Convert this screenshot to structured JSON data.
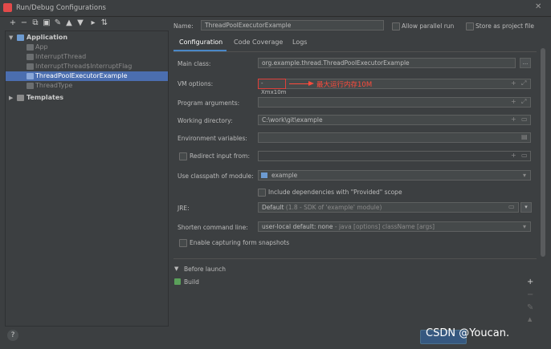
{
  "window": {
    "title": "Run/Debug Configurations"
  },
  "toolbar": {
    "icons": [
      "plus-icon",
      "minus-icon",
      "copy-icon",
      "save-icon",
      "wrench-icon",
      "arrow-up-icon",
      "arrow-down-icon",
      "folder-icon",
      "sort-icon"
    ],
    "glyphs": [
      "+",
      "−",
      "⧉",
      "▣",
      "✎",
      "▲",
      "▼",
      "▸",
      "⇅"
    ]
  },
  "tree": {
    "application_label": "Application",
    "items": [
      {
        "label": "App",
        "selected": false
      },
      {
        "label": "InterruptThread",
        "selected": false
      },
      {
        "label": "InterruptThread$InterruptFlag",
        "selected": false
      },
      {
        "label": "ThreadPoolExecutorExample",
        "selected": true
      },
      {
        "label": "ThreadType",
        "selected": false
      }
    ],
    "templates_label": "Templates"
  },
  "header": {
    "name_label": "Name:",
    "name_value": "ThreadPoolExecutorExample",
    "allow_parallel_label": "Allow parallel run",
    "store_project_label": "Store as project file"
  },
  "tabs": [
    "Configuration",
    "Code Coverage",
    "Logs"
  ],
  "form": {
    "main_class_label": "Main class:",
    "main_class_value": "org.example.thread.ThreadPoolExecutorExample",
    "vm_options_label": "VM options:",
    "vm_options_value": "-Xmx10m",
    "annotation_text": "最大运行内存10M",
    "program_args_label": "Program arguments:",
    "working_dir_label": "Working directory:",
    "working_dir_value": "C:\\work\\git\\example",
    "env_vars_label": "Environment variables:",
    "redirect_input_label": "Redirect input from:",
    "classpath_label": "Use classpath of module:",
    "classpath_value": "example",
    "include_deps_label": "Include dependencies with \"Provided\" scope",
    "jre_label": "JRE:",
    "jre_value": "Default",
    "jre_hint": "(1.8 - SDK of 'example' module)",
    "shorten_label": "Shorten command line:",
    "shorten_value": "user-local default: none",
    "shorten_hint": "- java [options] className [args]",
    "capture_label": "Enable capturing form snapshots"
  },
  "before_launch": {
    "label": "Before launch",
    "build_label": "Build"
  },
  "watermark": "CSDN @Youcan.",
  "help_glyph": "?"
}
